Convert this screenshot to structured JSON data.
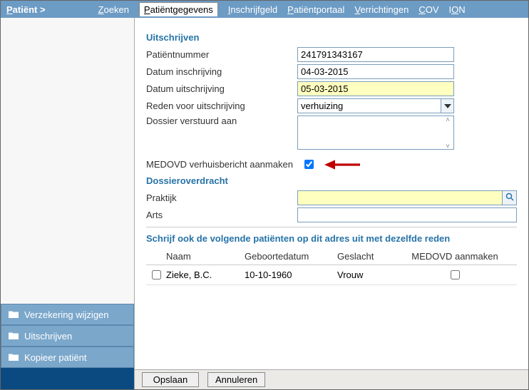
{
  "breadcrumb": "Patiënt >",
  "tabs": {
    "zoeken": "Zoeken",
    "patientgegevens": "Patiëntgegevens",
    "inschrijfgeld": "Inschrijfgeld",
    "patientportaal": "Patiëntportaal",
    "verrichtingen": "Verrichtingen",
    "cov": "COV",
    "ion": "ION"
  },
  "sidebar": {
    "verzekering": "Verzekering wijzigen",
    "uitschrijven": "Uitschrijven",
    "kopieer": "Kopieer patiënt"
  },
  "section": {
    "uitschrijven_title": "Uitschrijven",
    "dossieroverdracht_title": "Dossieroverdracht",
    "patients_title": "Schrijf ook de volgende patiënten op dit adres uit met dezelfde reden"
  },
  "form": {
    "patientnummer_label": "Patiëntnummer",
    "patientnummer_value": "241791343167",
    "datum_inschrijving_label": "Datum inschrijving",
    "datum_inschrijving_value": "04-03-2015",
    "datum_uitschrijving_label": "Datum uitschrijving",
    "datum_uitschrijving_value": "05-03-2015",
    "reden_label": "Reden voor uitschrijving",
    "reden_value": "verhuizing",
    "dossier_verstuurd_label": "Dossier verstuurd aan",
    "dossier_verstuurd_value": "",
    "medovd_label": "MEDOVD verhuisbericht aanmaken",
    "medovd_checked": true,
    "praktijk_label": "Praktijk",
    "praktijk_value": "",
    "arts_label": "Arts",
    "arts_value": ""
  },
  "table": {
    "headers": {
      "naam": "Naam",
      "geboortedatum": "Geboortedatum",
      "geslacht": "Geslacht",
      "medovd": "MEDOVD aanmaken"
    },
    "rows": [
      {
        "naam": "Zieke, B.C.",
        "geboortedatum": "10-10-1960",
        "geslacht": "Vrouw",
        "medovd_checked": false,
        "selected": false
      }
    ]
  },
  "buttons": {
    "opslaan": "Opslaan",
    "annuleren": "Annuleren"
  }
}
